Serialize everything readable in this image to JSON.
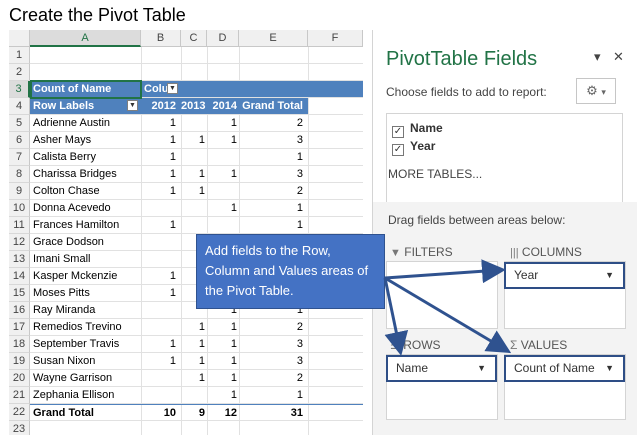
{
  "title": "Create the Pivot Table",
  "sheet": {
    "columns": [
      "A",
      "B",
      "C",
      "D",
      "E",
      "F"
    ],
    "row_numbers": [
      "1",
      "2",
      "3",
      "4",
      "5",
      "6",
      "7",
      "8",
      "9",
      "10",
      "11",
      "12",
      "13",
      "14",
      "15",
      "16",
      "17",
      "18",
      "19",
      "20",
      "21",
      "22",
      "23"
    ],
    "header_row3": {
      "a": "Count of Name",
      "b": "Colun"
    },
    "header_row4": {
      "a": "Row Labels",
      "b": "2012",
      "c": "2013",
      "d": "2014",
      "e": "Grand Total"
    },
    "rows": [
      {
        "name": "Adrienne Austin",
        "y2012": "1",
        "y2013": "",
        "y2014": "1",
        "total": "2"
      },
      {
        "name": "Asher Mays",
        "y2012": "1",
        "y2013": "1",
        "y2014": "1",
        "total": "3"
      },
      {
        "name": "Calista Berry",
        "y2012": "1",
        "y2013": "",
        "y2014": "",
        "total": "1"
      },
      {
        "name": "Charissa Bridges",
        "y2012": "1",
        "y2013": "1",
        "y2014": "1",
        "total": "3"
      },
      {
        "name": "Colton Chase",
        "y2012": "1",
        "y2013": "1",
        "y2014": "",
        "total": "2"
      },
      {
        "name": "Donna Acevedo",
        "y2012": "",
        "y2013": "",
        "y2014": "1",
        "total": "1"
      },
      {
        "name": "Frances Hamilton",
        "y2012": "1",
        "y2013": "",
        "y2014": "",
        "total": "1"
      },
      {
        "name": "Grace Dodson",
        "y2012": "",
        "y2013": "",
        "y2014": "",
        "total": ""
      },
      {
        "name": "Imani Small",
        "y2012": "",
        "y2013": "",
        "y2014": "",
        "total": ""
      },
      {
        "name": "Kasper Mckenzie",
        "y2012": "1",
        "y2013": "",
        "y2014": "",
        "total": ""
      },
      {
        "name": "Moses Pitts",
        "y2012": "1",
        "y2013": "",
        "y2014": "",
        "total": ""
      },
      {
        "name": "Ray Miranda",
        "y2012": "",
        "y2013": "",
        "y2014": "1",
        "total": "1"
      },
      {
        "name": "Remedios Trevino",
        "y2012": "",
        "y2013": "1",
        "y2014": "1",
        "total": "2"
      },
      {
        "name": "September Travis",
        "y2012": "1",
        "y2013": "1",
        "y2014": "1",
        "total": "3"
      },
      {
        "name": "Susan Nixon",
        "y2012": "1",
        "y2013": "1",
        "y2014": "1",
        "total": "3"
      },
      {
        "name": "Wayne Garrison",
        "y2012": "",
        "y2013": "1",
        "y2014": "1",
        "total": "2"
      },
      {
        "name": "Zephania Ellison",
        "y2012": "",
        "y2013": "",
        "y2014": "1",
        "total": "1"
      }
    ],
    "grand_total": {
      "name": "Grand Total",
      "y2012": "10",
      "y2013": "9",
      "y2014": "12",
      "total": "31"
    }
  },
  "callout": {
    "text": "Add fields to the Row, Column and Values areas of the Pivot Table."
  },
  "pane": {
    "title": "PivotTable Fields",
    "dropdown_icon": "▾",
    "close_icon": "✕",
    "subtitle": "Choose fields to add to report:",
    "gear_icon": "⚙",
    "gear_arrow": "▾",
    "fields": [
      {
        "label": "Name",
        "checked": true
      },
      {
        "label": "Year",
        "checked": true
      }
    ],
    "more_tables": "MORE TABLES...",
    "drag_label": "Drag fields between areas below:",
    "areas": {
      "filters": "FILTERS",
      "columns": "COLUMNS",
      "rows": "ROWS",
      "values": "VALUES"
    },
    "chips": {
      "columns": "Year",
      "rows": "Name",
      "values": "Count of Name"
    }
  },
  "colors": {
    "accent": "#217346",
    "pivot_header": "#4f81bd",
    "callout": "#4472c4",
    "chip_border": "#2e4e86"
  }
}
